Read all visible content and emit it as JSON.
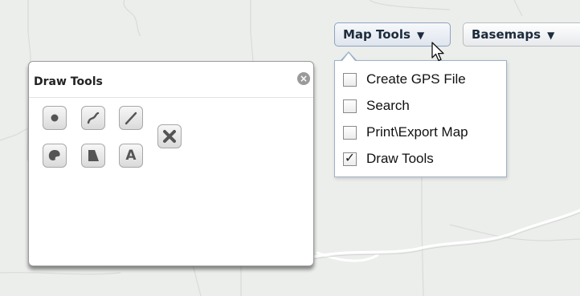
{
  "toolbar": {
    "map_tools_label": "Map Tools",
    "basemaps_label": "Basemaps",
    "caret_glyph": "▼"
  },
  "map_tools_menu": {
    "items": [
      {
        "label": "Create GPS File",
        "checked": false
      },
      {
        "label": "Search",
        "checked": false
      },
      {
        "label": "Print\\Export Map",
        "checked": false
      },
      {
        "label": "Draw Tools",
        "checked": true
      }
    ]
  },
  "draw_panel": {
    "title": "Draw Tools",
    "close_glyph": "×",
    "tools": [
      {
        "name": "point",
        "icon": "point-icon"
      },
      {
        "name": "freehand-line",
        "icon": "freehand-line-icon"
      },
      {
        "name": "line",
        "icon": "line-icon"
      },
      {
        "name": "freehand-polygon",
        "icon": "freehand-polygon-icon"
      },
      {
        "name": "polygon",
        "icon": "polygon-icon"
      },
      {
        "name": "text",
        "icon": "text-icon",
        "label": "A"
      },
      {
        "name": "clear",
        "icon": "clear-x-icon"
      }
    ]
  },
  "colors": {
    "map_background": "#eceeec",
    "map_lines": "#d7d9d7",
    "road": "#ffffff",
    "dropdown_border": "#9eb2c9",
    "tool_icon": "#555555"
  }
}
